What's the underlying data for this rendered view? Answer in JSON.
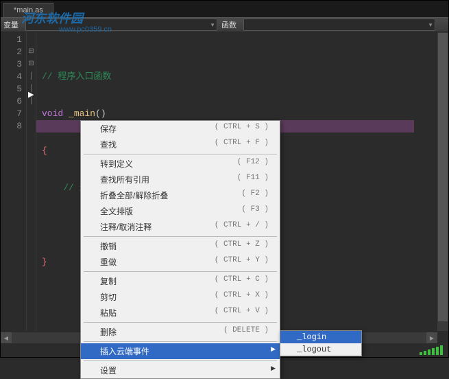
{
  "tab": {
    "title": "*main.as"
  },
  "toolbar": {
    "var_label": "变量",
    "func_label": "函数"
  },
  "code": {
    "lines": [
      "1",
      "2",
      "3",
      "4",
      "5",
      "6",
      "7",
      "8"
    ],
    "comment1": "// 程序入口函数",
    "keyword_void": "void",
    "func_main": " _main",
    "parens": "()",
    "brace_open": "{",
    "comment2": "// 这里开始脚本逻辑",
    "brace_close": "}"
  },
  "fold": {
    "minus1": "⊟",
    "line": "│",
    "minus2": "⊟"
  },
  "menu": {
    "save": {
      "label": "保存",
      "shortcut": "( CTRL + S )"
    },
    "find": {
      "label": "查找",
      "shortcut": "( CTRL + F )"
    },
    "gotodef": {
      "label": "转到定义",
      "shortcut": "( F12 )"
    },
    "findref": {
      "label": "查找所有引用",
      "shortcut": "( F11 )"
    },
    "fold": {
      "label": "折叠全部/解除折叠",
      "shortcut": "( F2 )"
    },
    "format": {
      "label": "全文排版",
      "shortcut": "( F3 )"
    },
    "comment": {
      "label": "注释/取消注释",
      "shortcut": "( CTRL + / )"
    },
    "undo": {
      "label": "撤销",
      "shortcut": "( CTRL + Z )"
    },
    "redo": {
      "label": "重做",
      "shortcut": "( CTRL + Y )"
    },
    "copy": {
      "label": "复制",
      "shortcut": "( CTRL + C )"
    },
    "cut": {
      "label": "剪切",
      "shortcut": "( CTRL + X )"
    },
    "paste": {
      "label": "粘贴",
      "shortcut": "( CTRL + V )"
    },
    "delete": {
      "label": "删除",
      "shortcut": "( DELETE )"
    },
    "cloud": {
      "label": "插入云端事件"
    },
    "settings": {
      "label": "设置"
    }
  },
  "submenu": {
    "login": "_login",
    "logout": "_logout"
  },
  "watermark": {
    "main": "河东软件园",
    "url": "www.pc0359.cn"
  }
}
